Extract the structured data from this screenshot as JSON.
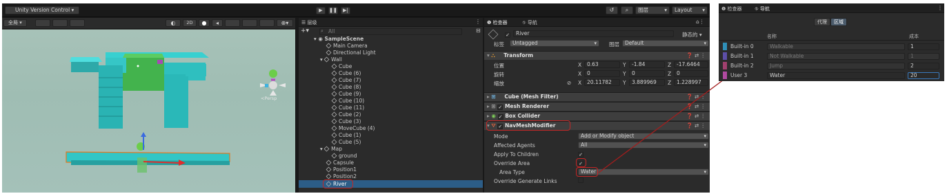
{
  "toolbar": {
    "account": "Unity Version Control",
    "layers": "图层",
    "layout": "Layout"
  },
  "scene": {
    "global": "全局",
    "mode_2d": "2D",
    "persp": "<Persp"
  },
  "hierarchy": {
    "tab": "层级",
    "search_placeholder": "All",
    "items": [
      "SampleScene",
      "Main Camera",
      "Directional Light",
      "Wall",
      "Cube",
      "Cube (6)",
      "Cube (7)",
      "Cube (8)",
      "Cube (9)",
      "Cube (10)",
      "Cube (11)",
      "Cube (2)",
      "Cube (3)",
      "MoveCube (4)",
      "Cube (1)",
      "Cube (5)",
      "Map",
      "ground",
      "Capsule",
      "Position1",
      "Position2",
      "River"
    ]
  },
  "inspector": {
    "tab1": "检查器",
    "tab2": "导航",
    "object_name": "River",
    "static": "静态的",
    "tag_label": "标签",
    "tag_value": "Untagged",
    "layer_label": "图层",
    "layer_value": "Default",
    "transform": "Transform",
    "pos_label": "位置",
    "rot_label": "旋转",
    "scale_label": "缩放",
    "pos": {
      "x": "0.63",
      "y": "-1.84",
      "z": "-17.6464"
    },
    "rot": {
      "x": "0",
      "y": "0",
      "z": "0"
    },
    "scale": {
      "x": "20.11782",
      "y": "3.889969",
      "z": "1.228997"
    },
    "components": [
      "Cube (Mesh Filter)",
      "Mesh Renderer",
      "Box Collider",
      "NavMeshModifier"
    ],
    "mode_label": "Mode",
    "mode_value": "Add or Modify object",
    "agents_label": "Affected Agents",
    "agents_value": "All",
    "children_label": "Apply To Children",
    "override_label": "Override Area",
    "area_label": "Area Type",
    "area_value": "Water",
    "gen_label": "Override Generate Links"
  },
  "navigation": {
    "tab1": "检查器",
    "tab2": "导航",
    "agents_btn": "代理",
    "areas_btn": "区域",
    "col_name": "名称",
    "col_cost": "成本",
    "rows": [
      {
        "slot": "Built-in 0",
        "name": "Walkable",
        "cost": "1",
        "color": "#2f8fb8"
      },
      {
        "slot": "Built-in 1",
        "name": "Not Walkable",
        "cost": "1",
        "color": "#5d4fa8"
      },
      {
        "slot": "Built-in 2",
        "name": "Jump",
        "cost": "2",
        "color": "#a0406e"
      },
      {
        "slot": "User 3",
        "name": "Water",
        "cost": "20",
        "color": "#b04aa0"
      }
    ]
  }
}
